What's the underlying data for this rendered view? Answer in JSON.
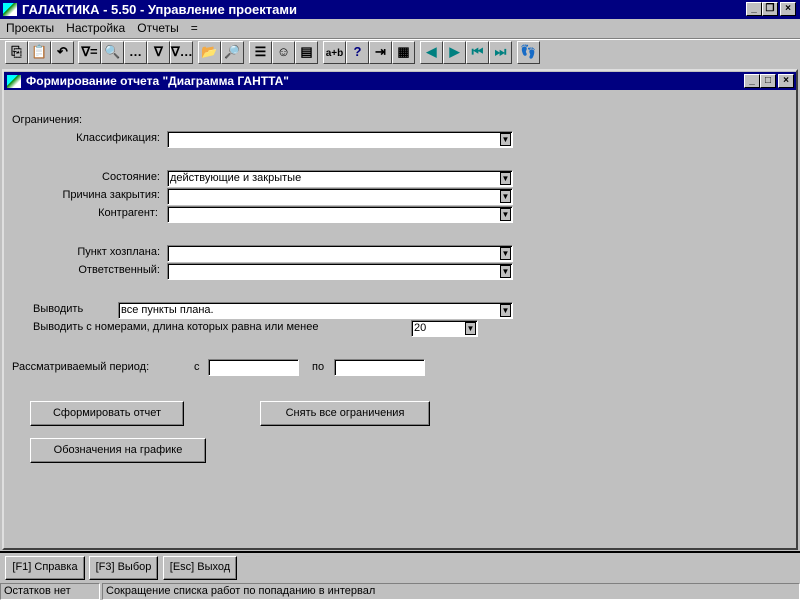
{
  "app": {
    "title": "ГАЛАКТИКА - 5.50 - Управление проектами"
  },
  "menu": [
    "Проекты",
    "Настройка",
    "Отчеты",
    "="
  ],
  "toolbar": [
    {
      "name": "copy-icon",
      "g": "⎘"
    },
    {
      "name": "paste-icon",
      "g": "📋"
    },
    {
      "name": "undo-icon",
      "g": "↶"
    },
    {
      "name": "filter-icon",
      "g": "∇="
    },
    {
      "name": "find-icon",
      "g": "🔍"
    },
    {
      "name": "find-more-icon",
      "g": "…"
    },
    {
      "name": "filter-find-icon",
      "g": "∇"
    },
    {
      "name": "filter-find-more-icon",
      "g": "∇…"
    },
    {
      "name": "open-folder-icon",
      "g": "📂"
    },
    {
      "name": "folder-search-icon",
      "g": "🔎"
    },
    {
      "name": "list-icon",
      "g": "☰"
    },
    {
      "name": "smiley-icon",
      "g": "☺"
    },
    {
      "name": "form-icon",
      "g": "▤"
    },
    {
      "name": "calculator-icon",
      "g": "a+b"
    },
    {
      "name": "help-icon",
      "g": "?"
    },
    {
      "name": "exit-door-icon",
      "g": "⇥"
    },
    {
      "name": "report-icon",
      "g": "▦"
    },
    {
      "name": "prev-icon",
      "g": "◀"
    },
    {
      "name": "next-icon",
      "g": "▶"
    },
    {
      "name": "first-icon",
      "g": "⏮"
    },
    {
      "name": "last-icon",
      "g": "⏭"
    },
    {
      "name": "footprints-icon",
      "g": "👣"
    }
  ],
  "window": {
    "title": "Формирование отчета \"Диаграмма ГАНТТА\""
  },
  "form": {
    "restrictions": "Ограничения:",
    "classification": {
      "label": "Классификация:",
      "value": ""
    },
    "state": {
      "label": "Состояние:",
      "value": "действующие и закрытые"
    },
    "close_reason": {
      "label": "Причина закрытия:",
      "value": ""
    },
    "counterparty": {
      "label": "Контрагент:",
      "value": ""
    },
    "plan_item": {
      "label": "Пункт хозплана:",
      "value": ""
    },
    "responsible": {
      "label": "Ответственный:",
      "value": ""
    },
    "output": {
      "label": "Выводить",
      "value": "все пункты плана."
    },
    "number_length": {
      "label": "Выводить с номерами, длина которых равна или менее",
      "value": "20"
    },
    "period": {
      "label": "Рассматриваемый период:",
      "from_label": "с",
      "from": "",
      "to_label": "по",
      "to": ""
    },
    "generate": "Сформировать отчет",
    "clear": "Снять все ограничения",
    "legend": "Обозначения на графике"
  },
  "bottom_buttons": [
    "[F1] Справка",
    "[F3] Выбор",
    "[Esc] Выход"
  ],
  "status": {
    "left": "Остатков нет",
    "right": "Сокращение списка работ по попаданию в интервал"
  }
}
